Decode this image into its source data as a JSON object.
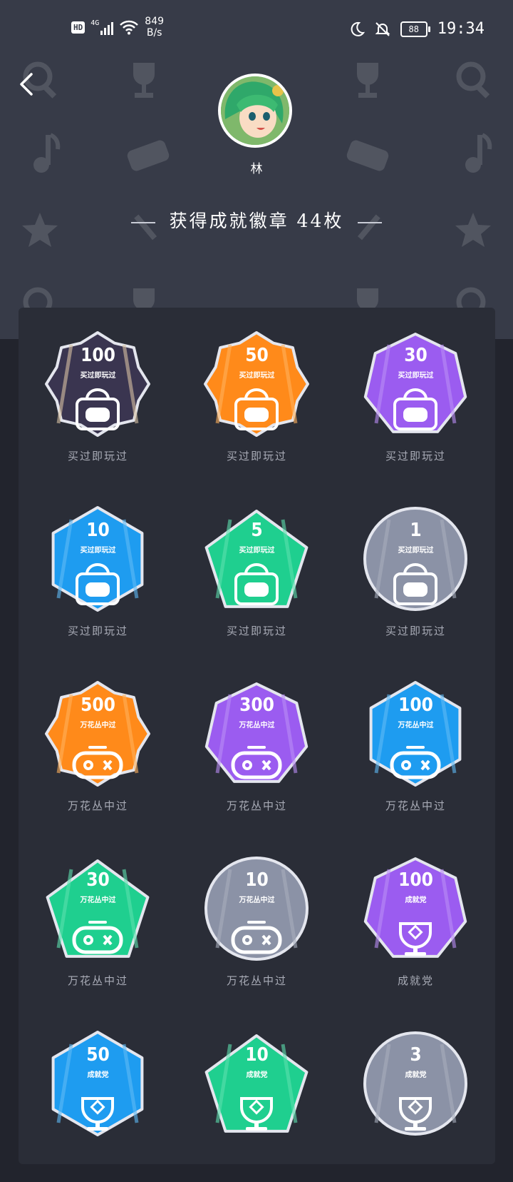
{
  "status_bar": {
    "network_badge": "HD",
    "signal_type": "4G",
    "speed_value": "849",
    "speed_unit": "B/s",
    "battery_level": "88",
    "time": "19:34",
    "icons": [
      "hd-icon",
      "signal-icon",
      "wifi-icon",
      "moon-icon",
      "mute-icon",
      "battery-icon"
    ]
  },
  "header": {
    "back_icon": "chevron-left-icon",
    "username": "林",
    "summary_title": "获得成就徽章 44枚"
  },
  "badges": [
    {
      "value": "100",
      "label": "买过即玩过",
      "name": "买过即玩过",
      "color": "#3a3550",
      "accent": "#d8c2a4",
      "shape": "rosette",
      "icon": "bag-gamepad-icon"
    },
    {
      "value": "50",
      "label": "买过即玩过",
      "name": "买过即玩过",
      "color": "#ff8a1a",
      "accent": "#ffb15c",
      "shape": "rosette",
      "icon": "bag-gamepad-icon"
    },
    {
      "value": "30",
      "label": "买过即玩过",
      "name": "买过即玩过",
      "color": "#9b5cf0",
      "accent": "#b98df5",
      "shape": "heptagon",
      "icon": "bag-gamepad-icon"
    },
    {
      "value": "10",
      "label": "买过即玩过",
      "name": "买过即玩过",
      "color": "#1e9cf0",
      "accent": "#5fbaf5",
      "shape": "hexagon",
      "icon": "bag-gamepad-icon"
    },
    {
      "value": "5",
      "label": "买过即玩过",
      "name": "买过即玩过",
      "color": "#1fcf8f",
      "accent": "#5ce0ae",
      "shape": "pentagon",
      "icon": "bag-gamepad-icon"
    },
    {
      "value": "1",
      "label": "买过即玩过",
      "name": "买过即玩过",
      "color": "#8b92a6",
      "accent": "#a8aebd",
      "shape": "circle",
      "icon": "bag-gamepad-icon"
    },
    {
      "value": "500",
      "label": "万花丛中过",
      "name": "万花丛中过",
      "color": "#ff8a1a",
      "accent": "#ffb15c",
      "shape": "rosette",
      "icon": "gamepad-icon"
    },
    {
      "value": "300",
      "label": "万花丛中过",
      "name": "万花丛中过",
      "color": "#9b5cf0",
      "accent": "#b98df5",
      "shape": "heptagon",
      "icon": "gamepad-icon"
    },
    {
      "value": "100",
      "label": "万花丛中过",
      "name": "万花丛中过",
      "color": "#1e9cf0",
      "accent": "#5fbaf5",
      "shape": "hexagon",
      "icon": "gamepad-icon"
    },
    {
      "value": "30",
      "label": "万花丛中过",
      "name": "万花丛中过",
      "color": "#1fcf8f",
      "accent": "#5ce0ae",
      "shape": "pentagon",
      "icon": "gamepad-icon"
    },
    {
      "value": "10",
      "label": "万花丛中过",
      "name": "万花丛中过",
      "color": "#8b92a6",
      "accent": "#a8aebd",
      "shape": "circle",
      "icon": "gamepad-icon"
    },
    {
      "value": "100",
      "label": "成就党",
      "name": "成就党",
      "color": "#9b5cf0",
      "accent": "#b98df5",
      "shape": "heptagon",
      "icon": "trophy-icon"
    },
    {
      "value": "50",
      "label": "成就党",
      "name": "",
      "color": "#1e9cf0",
      "accent": "#5fbaf5",
      "shape": "hexagon",
      "icon": "trophy-icon"
    },
    {
      "value": "10",
      "label": "成就党",
      "name": "",
      "color": "#1fcf8f",
      "accent": "#5ce0ae",
      "shape": "pentagon",
      "icon": "trophy-icon"
    },
    {
      "value": "3",
      "label": "成就党",
      "name": "",
      "color": "#8b92a6",
      "accent": "#a8aebd",
      "shape": "circle",
      "icon": "trophy-icon"
    }
  ]
}
